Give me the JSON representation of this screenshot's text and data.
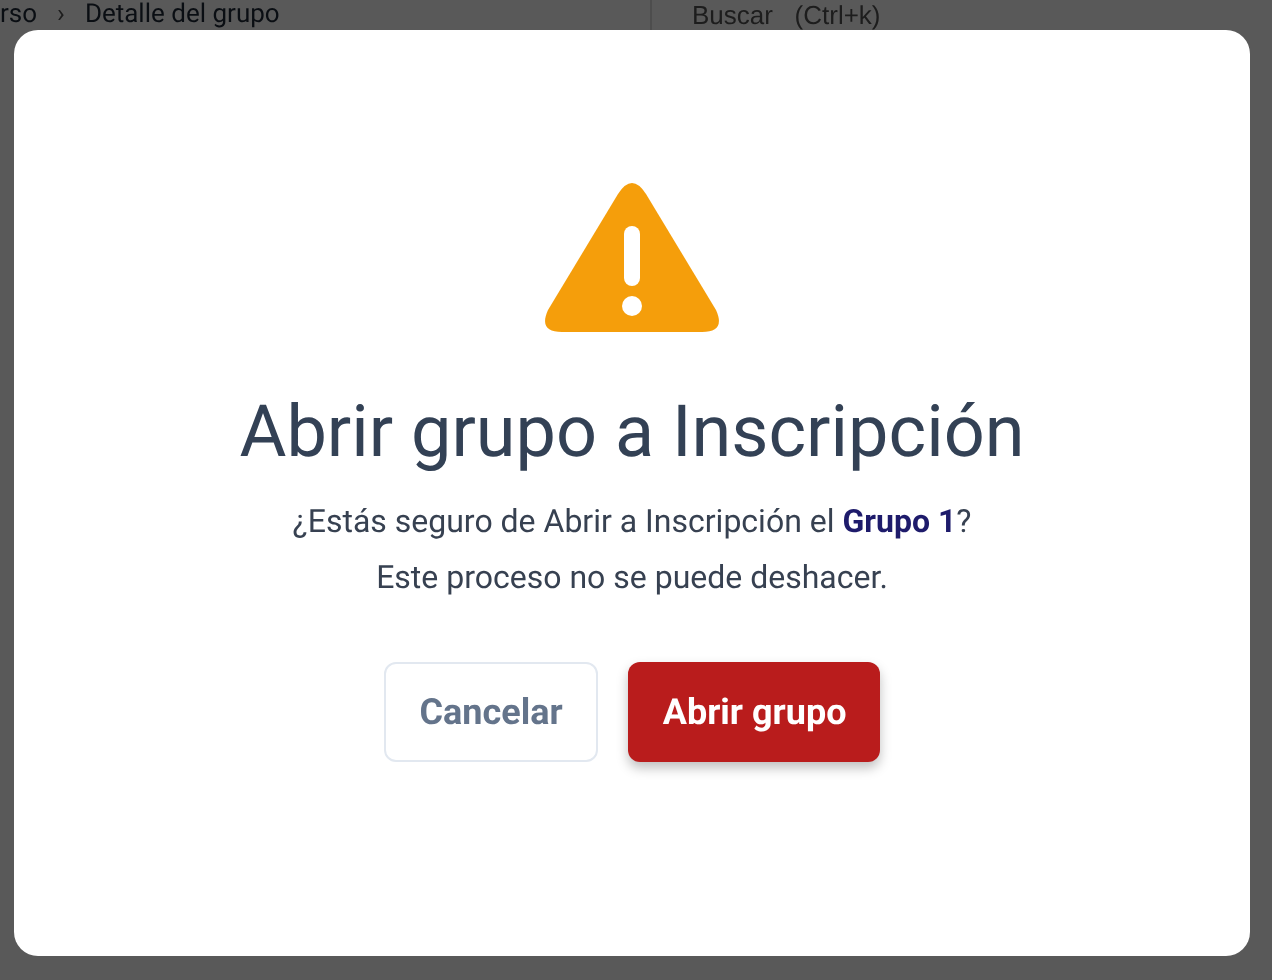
{
  "background": {
    "breadcrumb": [
      "rso",
      "›",
      "Detalle del grupo"
    ],
    "search": {
      "placeholder": "Buscar   (Ctrl+k)"
    }
  },
  "dialog": {
    "title": "Abrir grupo a Inscripción",
    "message": [
      "¿Estás seguro de Abrir a Inscripción el **Grupo 1**?",
      "Este proceso no se puede deshacer."
    ],
    "buttons": [
      {
        "label": "Cancelar",
        "kind": "secondary"
      },
      {
        "label": "Abrir grupo",
        "kind": "danger"
      }
    ]
  }
}
